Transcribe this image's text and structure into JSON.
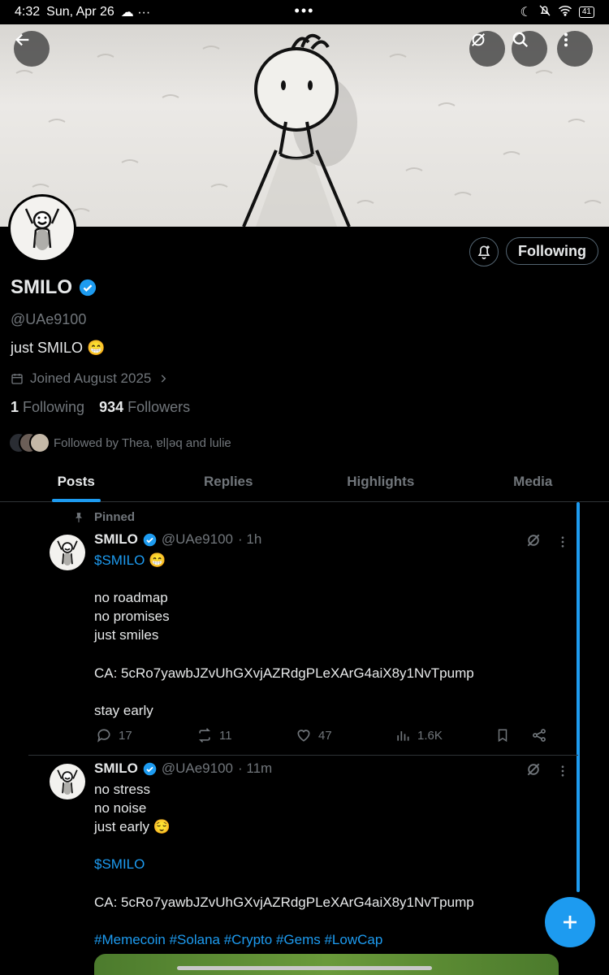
{
  "status_bar": {
    "time": "4:32",
    "date": "Sun, Apr 26",
    "extra": "☁ ···",
    "center_dots": "•••",
    "battery": "41"
  },
  "header": {
    "back_icon": "arrow-left-icon",
    "grok_icon": "grok-icon",
    "search_icon": "search-icon",
    "more_icon": "more-vertical-icon"
  },
  "profile": {
    "name": "SMILO",
    "handle": "@UAe9100",
    "bio": "just SMILO 😁",
    "joined": "Joined August 2025",
    "following_count": "1",
    "following_label": "Following",
    "followers_count": "934",
    "followers_label": "Followers",
    "followed_by": "Followed by Thea, ɐl|ǝq and lulie",
    "follow_button": "Following"
  },
  "tabs": [
    {
      "label": "Posts",
      "active": true
    },
    {
      "label": "Replies",
      "active": false
    },
    {
      "label": "Highlights",
      "active": false
    },
    {
      "label": "Media",
      "active": false
    }
  ],
  "posts": [
    {
      "pinned_label": "Pinned",
      "name": "SMILO",
      "handle": "@UAe9100",
      "time": "· 1h",
      "cashtag": "$SMILO",
      "emoji": " 😁",
      "body": "no roadmap\nno promises\njust smiles\n\nCA: 5cRo7yawbJZvUhGXvjAZRdgPLeXArG4aiX8y1NvTpump\n\nstay early",
      "replies": "17",
      "reposts": "11",
      "likes": "47",
      "views": "1.6K"
    },
    {
      "name": "SMILO",
      "handle": "@UAe9100",
      "time": "· 11m",
      "body": "no stress\nno noise\njust early 😌",
      "cashtag": "$SMILO",
      "ca": "CA: 5cRo7yawbJZvUhGXvjAZRdgPLeXArG4aiX8y1NvTpump",
      "hashtags": "#Memecoin #Solana #Crypto #Gems #LowCap"
    }
  ],
  "colors": {
    "accent": "#1d9bf0",
    "muted": "#71767b",
    "text": "#e7e9ea",
    "background": "#000000"
  }
}
